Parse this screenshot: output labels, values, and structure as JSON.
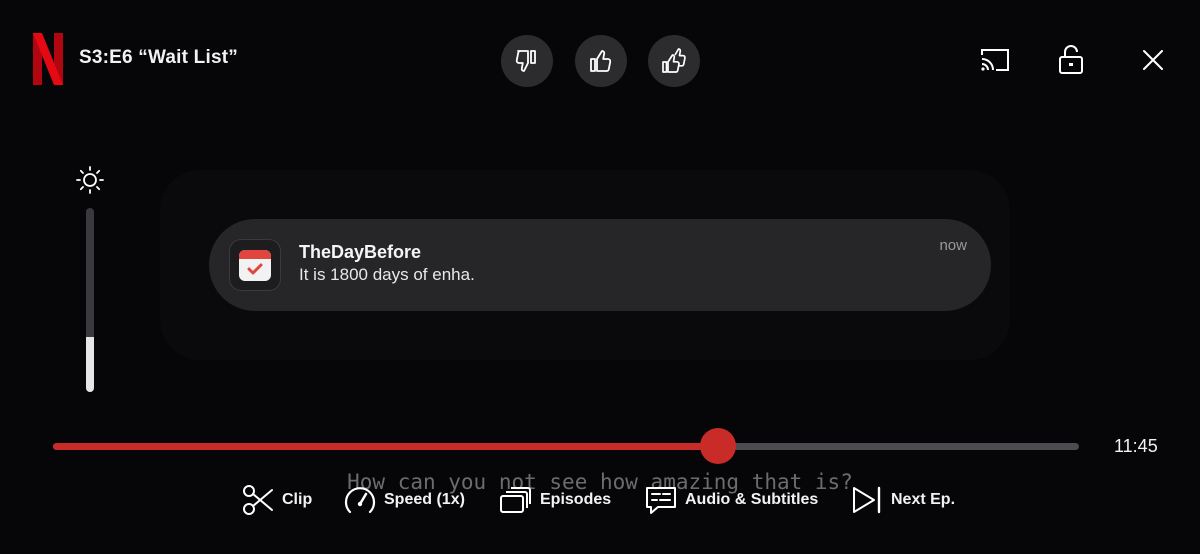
{
  "header": {
    "logo_letter": "N",
    "episode_title": "S3:E6 “Wait List”"
  },
  "rating": {
    "buttons": [
      {
        "name": "thumbs-down"
      },
      {
        "name": "thumbs-up"
      },
      {
        "name": "love-this"
      }
    ]
  },
  "notification": {
    "app_name": "TheDayBefore",
    "message": "It is 1800 days of enha.",
    "time": "now"
  },
  "brightness": {
    "level": 0.3
  },
  "playback": {
    "progress": 0.648,
    "time_remaining": "11:45",
    "subtitle": "How can you not see how amazing that is?"
  },
  "controls": {
    "clip": "Clip",
    "speed": "Speed (1x)",
    "episodes": "Episodes",
    "audio_subtitles": "Audio & Subtitles",
    "next_episode": "Next Ep."
  },
  "colors": {
    "accent": "#c82b28",
    "background": "#060508",
    "notification_bg": "#262628"
  }
}
